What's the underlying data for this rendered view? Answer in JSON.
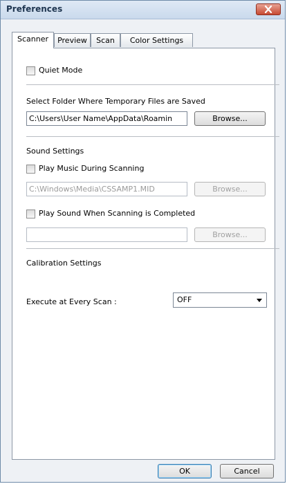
{
  "window": {
    "title": "Preferences"
  },
  "tabs": [
    {
      "label": "Scanner",
      "active": true
    },
    {
      "label": "Preview",
      "active": false
    },
    {
      "label": "Scan",
      "active": false
    },
    {
      "label": "Color Settings",
      "active": false
    }
  ],
  "quiet_mode": {
    "label": "Quiet Mode",
    "checked": false
  },
  "temp_folder": {
    "heading": "Select Folder Where Temporary Files are Saved",
    "value": "C:\\Users\\User Name\\AppData\\Roamin",
    "browse_label": "Browse..."
  },
  "sound": {
    "heading": "Sound Settings",
    "play_music": {
      "label": "Play Music During Scanning",
      "checked": false
    },
    "music_file": "C:\\Windows\\Media\\CSSAMP1.MID",
    "music_browse_label": "Browse...",
    "play_sound": {
      "label": "Play Sound When Scanning is Completed",
      "checked": false
    },
    "sound_file": "",
    "sound_browse_label": "Browse..."
  },
  "calibration": {
    "heading": "Calibration Settings",
    "execute_label": "Execute at Every Scan :",
    "execute_value": "OFF"
  },
  "footer": {
    "ok_label": "OK",
    "cancel_label": "Cancel"
  }
}
